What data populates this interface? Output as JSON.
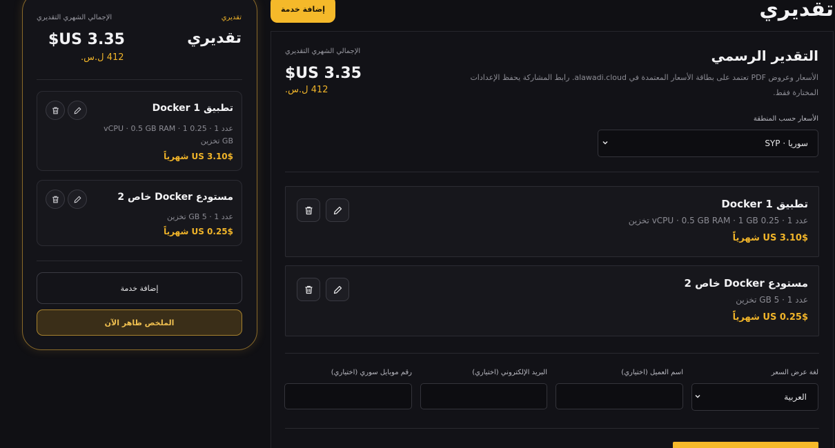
{
  "page": {
    "title": "تقديري",
    "add_service_label": "إضافة خدمة"
  },
  "summary": {
    "tag": "تقديري",
    "title": "تقديري",
    "monthly_label": "الإجمالي الشهري التقديري",
    "total_usd": "$US 3.35",
    "total_syp": "412 ل.س.",
    "items": [
      {
        "name": "تطبيق Docker 1",
        "detail_line1": "عدد 1 · 0.25 vCPU · 0.5 GB RAM · 1",
        "detail_line2": "GB تخزين",
        "price": "$US 3.10 شهرياً"
      },
      {
        "name": "مستودع Docker خاص 2",
        "detail_line1": "عدد 1 · 5 GB تخزين",
        "detail_line2": "",
        "price": "$US 0.25 شهرياً"
      }
    ],
    "add_service_label": "إضافة خدمة",
    "summary_visible_label": "الملخص ظاهر الآن"
  },
  "main": {
    "heading": "التقدير الرسمي",
    "description": "الأسعار وعروض PDF تعتمد على بطاقة الأسعار المعتمدة في alawadi.cloud. رابط المشاركة يحفظ الإعدادات المختارة فقط.",
    "monthly_label": "الإجمالي الشهري التقديري",
    "total_usd": "$US 3.35",
    "total_syp": "412 ل.س.",
    "region_label": "الأسعار حسب المنطقة",
    "region_value": "سوريا · SYP",
    "services": [
      {
        "name": "تطبيق Docker 1",
        "detail": "عدد 1 · 0.25 vCPU · 0.5 GB RAM · 1 GB تخزين",
        "price": "$US 3.10 شهرياً"
      },
      {
        "name": "مستودع Docker خاص 2",
        "detail": "عدد 1 · 5 GB تخزين",
        "price": "$US 0.25 شهرياً"
      }
    ],
    "form": {
      "language_label": "لغة عرض السعر",
      "language_value": "العربية",
      "client_label": "اسم العميل (اختياري)",
      "email_label": "البريد الإلكتروني (اختياري)",
      "mobile_label": "رقم موبايل سوري (اختياري)"
    }
  },
  "icons": {
    "edit": "pencil-icon",
    "delete": "trash-icon",
    "dropdown": "chevron-down-icon"
  },
  "colors": {
    "accent": "#f5b92a",
    "price": "#f0b429",
    "background": "#101014"
  }
}
